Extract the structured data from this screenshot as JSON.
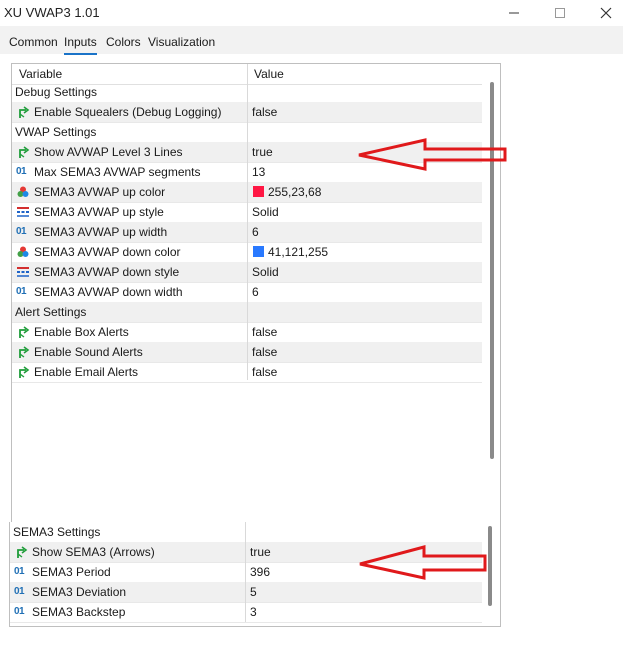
{
  "window": {
    "title": "XU VWAP3 1.01",
    "minimize_icon": "minimize-icon",
    "maximize_icon": "maximize-icon",
    "close_icon": "close-icon"
  },
  "tabs": [
    {
      "label": "Common"
    },
    {
      "label": "Inputs",
      "active": true
    },
    {
      "label": "Colors"
    },
    {
      "label": "Visualization"
    }
  ],
  "table": {
    "header": {
      "variable": "Variable",
      "value": "Value"
    },
    "rows": [
      {
        "type": "group",
        "label": "Debug Settings",
        "value": ""
      },
      {
        "icon": "bool-icon",
        "label": "Enable Squealers (Debug Logging)",
        "value": "false"
      },
      {
        "type": "group",
        "label": "VWAP Settings",
        "value": ""
      },
      {
        "icon": "bool-icon",
        "label": "Show AVWAP Level 3 Lines",
        "value": "true"
      },
      {
        "icon": "int-icon",
        "label": "Max SEMA3 AVWAP segments",
        "value": "13"
      },
      {
        "icon": "color-icon",
        "label": "SEMA3 AVWAP up color",
        "value": "255,23,68",
        "swatch": "#ff1744"
      },
      {
        "icon": "style-icon",
        "label": "SEMA3 AVWAP up style",
        "value": "Solid"
      },
      {
        "icon": "int-icon",
        "label": "SEMA3 AVWAP up width",
        "value": "6"
      },
      {
        "icon": "color-icon",
        "label": "SEMA3 AVWAP down color",
        "value": "41,121,255",
        "swatch": "#2979ff"
      },
      {
        "icon": "style-icon",
        "label": "SEMA3 AVWAP down style",
        "value": "Solid"
      },
      {
        "icon": "int-icon",
        "label": "SEMA3 AVWAP down width",
        "value": "6"
      },
      {
        "type": "group",
        "label": "Alert Settings",
        "value": ""
      },
      {
        "icon": "bool-icon",
        "label": "Enable Box Alerts",
        "value": "false"
      },
      {
        "icon": "bool-icon",
        "label": "Enable Sound Alerts",
        "value": "false"
      },
      {
        "icon": "bool-icon",
        "label": "Enable Email Alerts",
        "value": "false"
      }
    ]
  },
  "table2": {
    "rows": [
      {
        "type": "group",
        "label": "SEMA3 Settings",
        "value": ""
      },
      {
        "icon": "bool-icon",
        "label": "Show SEMA3 (Arrows)",
        "value": "true"
      },
      {
        "icon": "int-icon",
        "label": "SEMA3 Period",
        "value": "396"
      },
      {
        "icon": "int-icon",
        "label": "SEMA3 Deviation",
        "value": "5"
      },
      {
        "icon": "int-icon",
        "label": "SEMA3 Backstep",
        "value": "3"
      }
    ]
  },
  "icons": {
    "int_glyph": "01"
  },
  "colors": {
    "accent": "#1a73c8",
    "annotation_arrow": "#e0191b",
    "bool_icon": "#1f9d3a"
  }
}
